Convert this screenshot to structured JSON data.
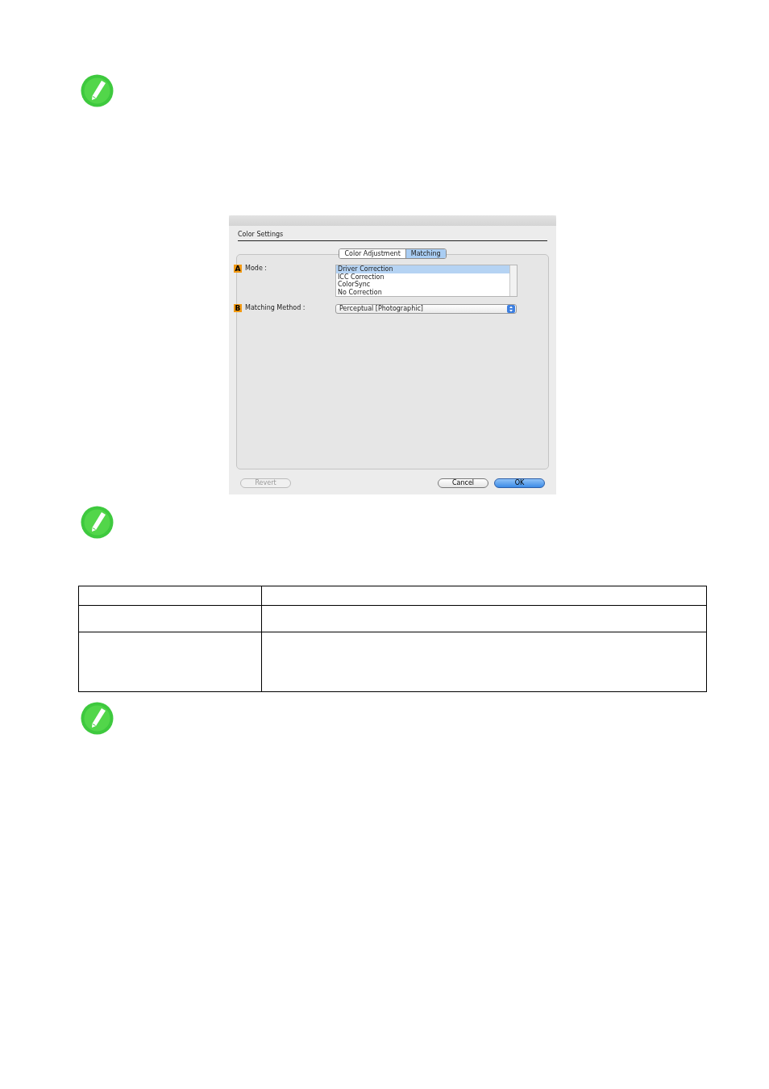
{
  "dialog": {
    "title": "Color Settings",
    "tabs": [
      {
        "label": "Color Adjustment",
        "selected": false
      },
      {
        "label": "Matching",
        "selected": true
      }
    ],
    "fields": [
      {
        "kind": "list",
        "badge": "A",
        "label": "Mode :",
        "options": [
          {
            "label": "Driver Correction",
            "selected": true
          },
          {
            "label": "ICC Correction",
            "selected": false
          },
          {
            "label": "ColorSync",
            "selected": false
          },
          {
            "label": "No Correction",
            "selected": false
          }
        ]
      },
      {
        "kind": "select",
        "badge": "B",
        "label": "Matching Method :",
        "value": "Perceptual [Photographic]"
      }
    ],
    "buttons": [
      {
        "label": "Revert",
        "disabled": true,
        "default": false
      },
      {
        "label": "Cancel",
        "disabled": false,
        "default": false
      },
      {
        "label": "OK",
        "disabled": false,
        "default": true
      }
    ]
  }
}
